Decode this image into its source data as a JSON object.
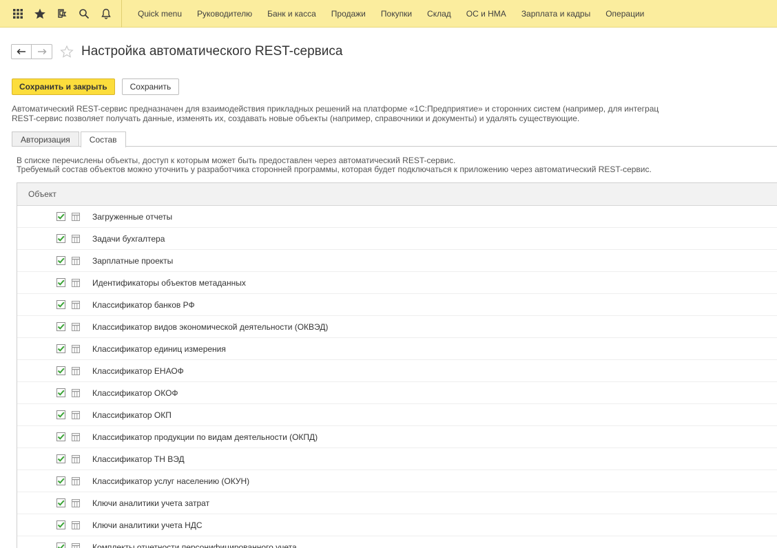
{
  "topbar": {
    "icons": [
      "apps-grid-icon",
      "favorites-star-icon",
      "history-icon",
      "search-icon",
      "notifications-bell-icon"
    ],
    "menu": [
      "Quick menu",
      "Руководителю",
      "Банк и касса",
      "Продажи",
      "Покупки",
      "Склад",
      "ОС и НМА",
      "Зарплата и кадры",
      "Операции"
    ]
  },
  "header": {
    "title": "Настройка автоматического REST-сервиса"
  },
  "buttons": {
    "save_close": "Сохранить и закрыть",
    "save": "Сохранить"
  },
  "description": {
    "line1": "Автоматический REST-сервис предназначен для взаимодействия прикладных решений на платформе «1С:Предприятие» и сторонних систем (например, для интеграц",
    "line2": "REST-сервис позволяет получать данные, изменять их, создавать новые объекты (например, справочники и документы) и удалять существующие."
  },
  "tabs": [
    {
      "label": "Авторизация",
      "active": false
    },
    {
      "label": "Состав",
      "active": true
    }
  ],
  "info": {
    "line1": "В списке перечислены объекты, доступ к которым может быть предоставлен через автоматический REST-сервис.",
    "line2": "Требуемый состав объектов можно уточнить у разработчика сторонней программы, которая будет подключаться к приложению через автоматический REST-сервис."
  },
  "table": {
    "header": "Объект",
    "rows": [
      {
        "label": "Загруженные отчеты",
        "checked": true
      },
      {
        "label": "Задачи бухгалтера",
        "checked": true
      },
      {
        "label": "Зарплатные проекты",
        "checked": true
      },
      {
        "label": "Идентификаторы объектов метаданных",
        "checked": true
      },
      {
        "label": "Классификатор банков РФ",
        "checked": true
      },
      {
        "label": "Классификатор видов экономической деятельности (ОКВЭД)",
        "checked": true
      },
      {
        "label": "Классификатор единиц измерения",
        "checked": true
      },
      {
        "label": "Классификатор ЕНАОФ",
        "checked": true
      },
      {
        "label": "Классификатор ОКОФ",
        "checked": true
      },
      {
        "label": "Классификатор ОКП",
        "checked": true
      },
      {
        "label": "Классификатор продукции по видам деятельности (ОКПД)",
        "checked": true
      },
      {
        "label": "Классификатор ТН ВЭД",
        "checked": true
      },
      {
        "label": "Классификатор услуг населению (ОКУН)",
        "checked": true
      },
      {
        "label": "Ключи аналитики учета затрат",
        "checked": true
      },
      {
        "label": "Ключи аналитики учета НДС",
        "checked": true
      },
      {
        "label": "Комплекты отчетности персонифицированного учета",
        "checked": true
      }
    ]
  },
  "colors": {
    "topbar_bg": "#fbed9e",
    "primary_button": "#fcdd3c",
    "check_green": "#3aa335",
    "table_icon": "#9a9a9a"
  }
}
